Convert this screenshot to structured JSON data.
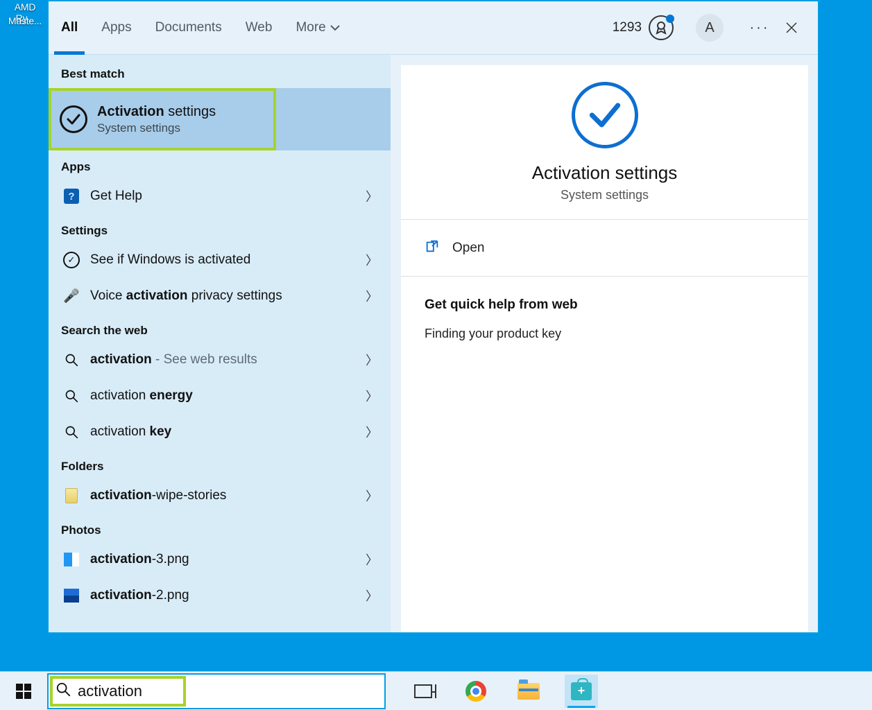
{
  "desktop": {
    "icon1": "AMD Ry...",
    "icon2": "Maste..."
  },
  "header": {
    "tabs": {
      "all": "All",
      "apps": "Apps",
      "documents": "Documents",
      "web": "Web",
      "more": "More"
    },
    "rewards_count": "1293",
    "avatar_initial": "A"
  },
  "sections": {
    "best_match": "Best match",
    "apps": "Apps",
    "settings": "Settings",
    "search_web": "Search the web",
    "folders": "Folders",
    "photos": "Photos"
  },
  "best_match": {
    "title_bold": "Activation",
    "title_rest": " settings",
    "subtitle": "System settings"
  },
  "apps_list": {
    "get_help": "Get Help"
  },
  "settings_list": {
    "see_activated": "See if Windows is activated",
    "voice_pre": "Voice ",
    "voice_bold": "activation",
    "voice_post": " privacy settings"
  },
  "web_list": {
    "w1_bold": "activation",
    "w1_suffix": " - See web results",
    "w2_pre": "activation ",
    "w2_bold": "energy",
    "w3_pre": "activation ",
    "w3_bold": "key"
  },
  "folders_list": {
    "f1_bold": "activation",
    "f1_rest": "-wipe-stories"
  },
  "photos_list": {
    "p1_bold": "activation",
    "p1_rest": "-3.png",
    "p2_bold": "activation",
    "p2_rest": "-2.png"
  },
  "detail": {
    "title": "Activation settings",
    "subtitle": "System settings",
    "open": "Open",
    "help_heading": "Get quick help from web",
    "help_link": "Finding your product key"
  },
  "search": {
    "value": "activation"
  }
}
